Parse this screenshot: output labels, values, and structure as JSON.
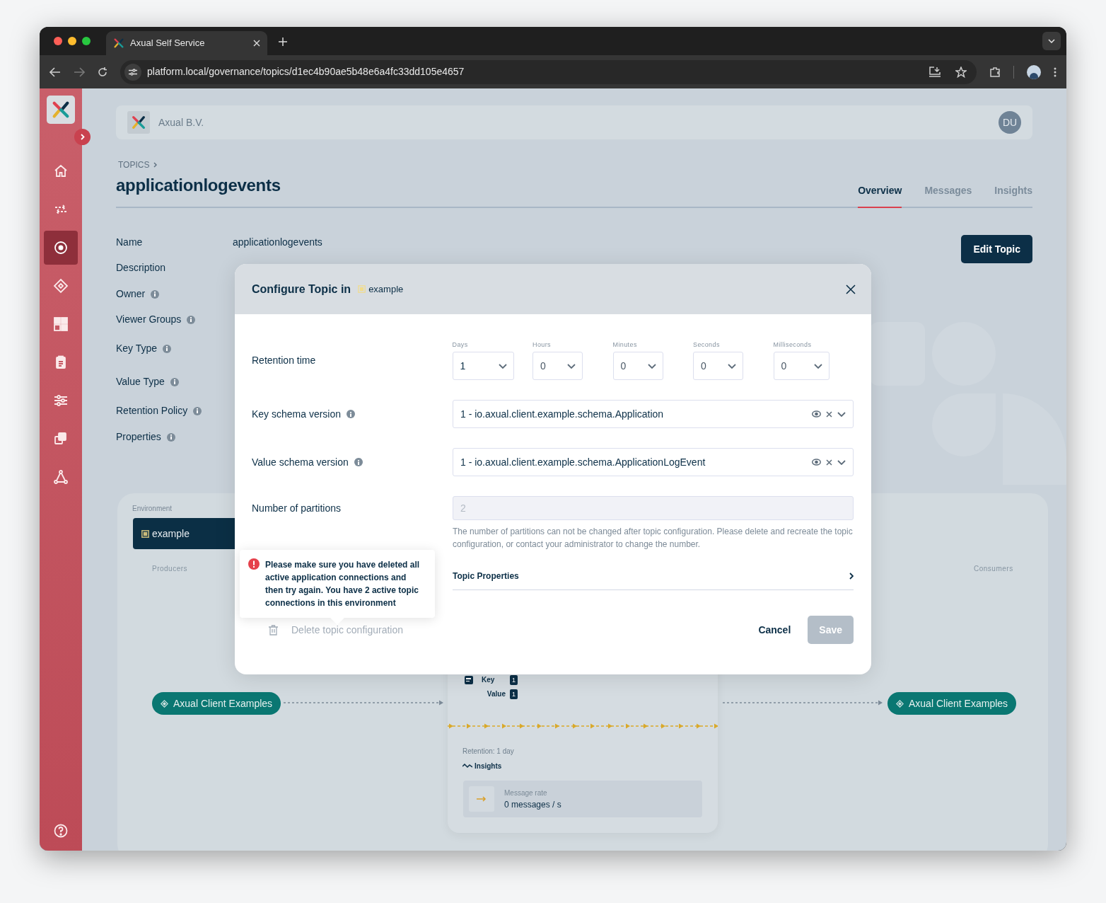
{
  "browser": {
    "tab_title": "Axual Self Service",
    "url": "platform.local/governance/topics/d1ec4b90ae5b48e6a4fc33dd105e4657"
  },
  "sidebar": {
    "items": [
      {
        "kind": "home",
        "selected": false
      },
      {
        "kind": "streams",
        "selected": false
      },
      {
        "kind": "topics",
        "selected": true
      },
      {
        "kind": "applications",
        "selected": false
      },
      {
        "kind": "grid",
        "selected": false
      },
      {
        "kind": "clipboard",
        "selected": false
      },
      {
        "kind": "sliders",
        "selected": false
      },
      {
        "kind": "copy",
        "selected": false
      },
      {
        "kind": "network",
        "selected": false
      }
    ],
    "help": true
  },
  "header": {
    "organization": "Axual B.V.",
    "avatar": "DU"
  },
  "breadcrumb": "TOPICS",
  "title": "applicationlogevents",
  "tabs": [
    {
      "label": "Overview",
      "selected": true
    },
    {
      "label": "Messages",
      "selected": false
    },
    {
      "label": "Insights",
      "selected": false
    }
  ],
  "details": [
    {
      "label": "Name",
      "value": "applicationlogevents"
    },
    {
      "label": "Description"
    },
    {
      "label": "Owner",
      "info": true
    },
    {
      "label": "Viewer Groups",
      "info": true
    },
    {
      "label": "Key Type",
      "info": true
    },
    {
      "label": "Value Type",
      "info": true
    },
    {
      "label": "Retention Policy",
      "info": true
    },
    {
      "label": "Properties",
      "info": true
    }
  ],
  "edit_button": "Edit Topic",
  "environment": {
    "label": "Environment",
    "selected_environment": "example",
    "producers_label": "Producers",
    "consumers_label": "Consumers",
    "producer": "Axual Client Examples",
    "consumer": "Axual Client Examples",
    "topic_card": {
      "key_label": "Key",
      "key_count": "1",
      "value_label": "Value",
      "value_count": "1",
      "retention": "Retention: 1 day",
      "insights": "Insights",
      "rate_label": "Message rate",
      "rate_value": "0 messages / s"
    }
  },
  "modal": {
    "title": "Configure Topic in",
    "environment": "example",
    "retention": {
      "label": "Retention time",
      "units": [
        {
          "label": "Days",
          "value": "1"
        },
        {
          "label": "Hours",
          "value": "0"
        },
        {
          "label": "Minutes",
          "value": "0"
        },
        {
          "label": "Seconds",
          "value": "0"
        },
        {
          "label": "Milliseconds",
          "value": "0"
        }
      ]
    },
    "schemas": [
      {
        "label": "Key schema version",
        "info": true,
        "value": "1 - io.axual.client.example.schema.Application"
      },
      {
        "label": "Value schema version",
        "info": true,
        "value": "1 - io.axual.client.example.schema.ApplicationLogEvent"
      }
    ],
    "partitions": {
      "label": "Number of partitions",
      "value": "2",
      "disabled": true,
      "hint": "The number of partitions can not be changed after topic configuration. Please delete and recreate the topic configuration, or contact your administrator to change the number."
    },
    "topic_properties": "Topic Properties",
    "tooltip": "Please make sure you have deleted all active application connections and then try again. You have 2 active topic connections in this environment",
    "delete": {
      "label": "Delete topic configuration",
      "disabled": true
    },
    "cancel": "Cancel",
    "save": {
      "label": "Save",
      "disabled": true
    }
  }
}
